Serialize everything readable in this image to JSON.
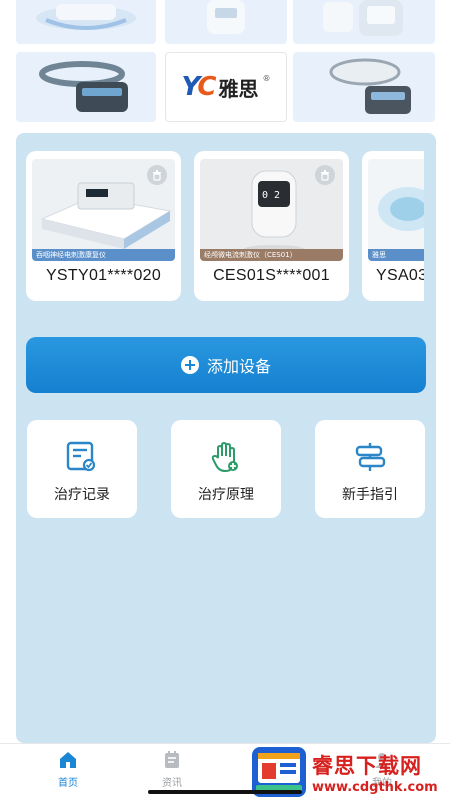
{
  "brand": {
    "mark": "YC",
    "name": "雅思",
    "reg": "®"
  },
  "devices": [
    {
      "name": "YSTY01****020",
      "caption": "吞咽神经电刺激康复仪",
      "caption_color": "#5b8fc9"
    },
    {
      "name": "CES01S****001",
      "caption": "经颅微电流刺激仪（CES01）",
      "caption_color": "#9a7b66"
    },
    {
      "name": "YSA03",
      "caption": "雅思",
      "caption_color": "#5b8fc9"
    }
  ],
  "add_device": {
    "label": "添加设备"
  },
  "functions": [
    {
      "label": "治疗记录",
      "icon": "record-icon"
    },
    {
      "label": "治疗原理",
      "icon": "hand-plus-icon"
    },
    {
      "label": "新手指引",
      "icon": "signpost-icon"
    }
  ],
  "nav": {
    "home": "首页",
    "news": "资讯",
    "mine": "我的"
  },
  "watermark": {
    "title": "睿思下载网",
    "url": "www.cdgthk.com"
  },
  "colors": {
    "accent": "#1a86d4",
    "panel": "#cce3f2",
    "watermark": "#d6211e"
  }
}
